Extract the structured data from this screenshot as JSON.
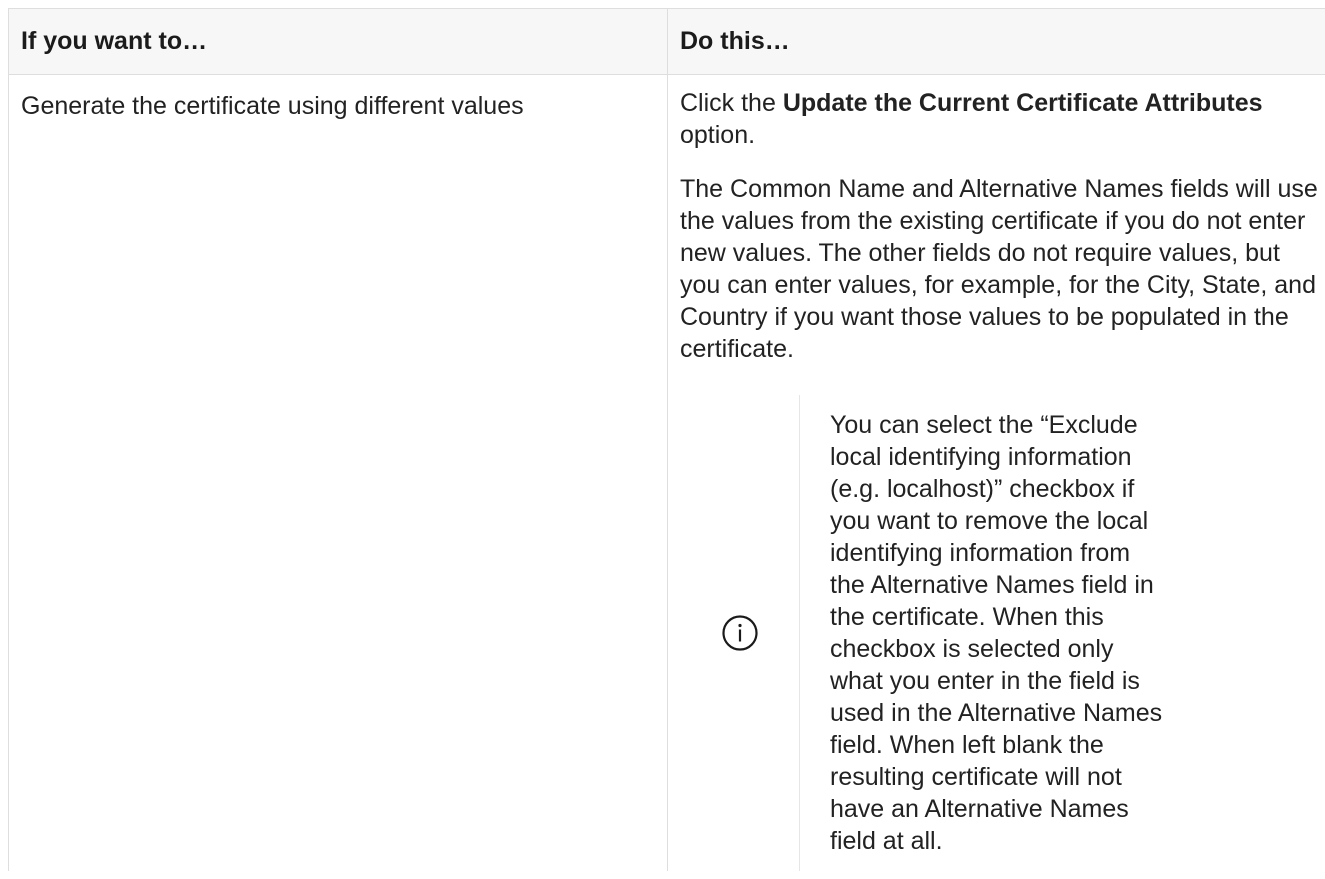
{
  "table": {
    "headers": [
      "If you want to…",
      "Do this…"
    ],
    "rows": [
      {
        "want": "Generate the certificate using different values",
        "action": {
          "p1_prefix": "Click the ",
          "p1_bold": "Update the Current Certificate Attributes",
          "p1_suffix": " option.",
          "p2": "The Common Name and Alternative Names fields will use the values from the existing certificate if you do not enter new values. The other fields do not require values, but you can enter values, for example, for the City, State, and Country if you want those values to be populated in the certificate.",
          "note": {
            "icon": "info-icon",
            "text": "You can select the “Exclude local identifying information (e.g. localhost)” checkbox if you want to remove the local identifying information from the Alternative Names field in the certificate. When this checkbox is selected only what you enter in the field is used in the Alternative Names field. When left blank the resulting certificate will not have an Alternative Names field at all."
          }
        }
      }
    ]
  },
  "colors": {
    "icon": "#1a1a1a",
    "border": "#dedede",
    "header_bg": "#f7f7f7"
  }
}
